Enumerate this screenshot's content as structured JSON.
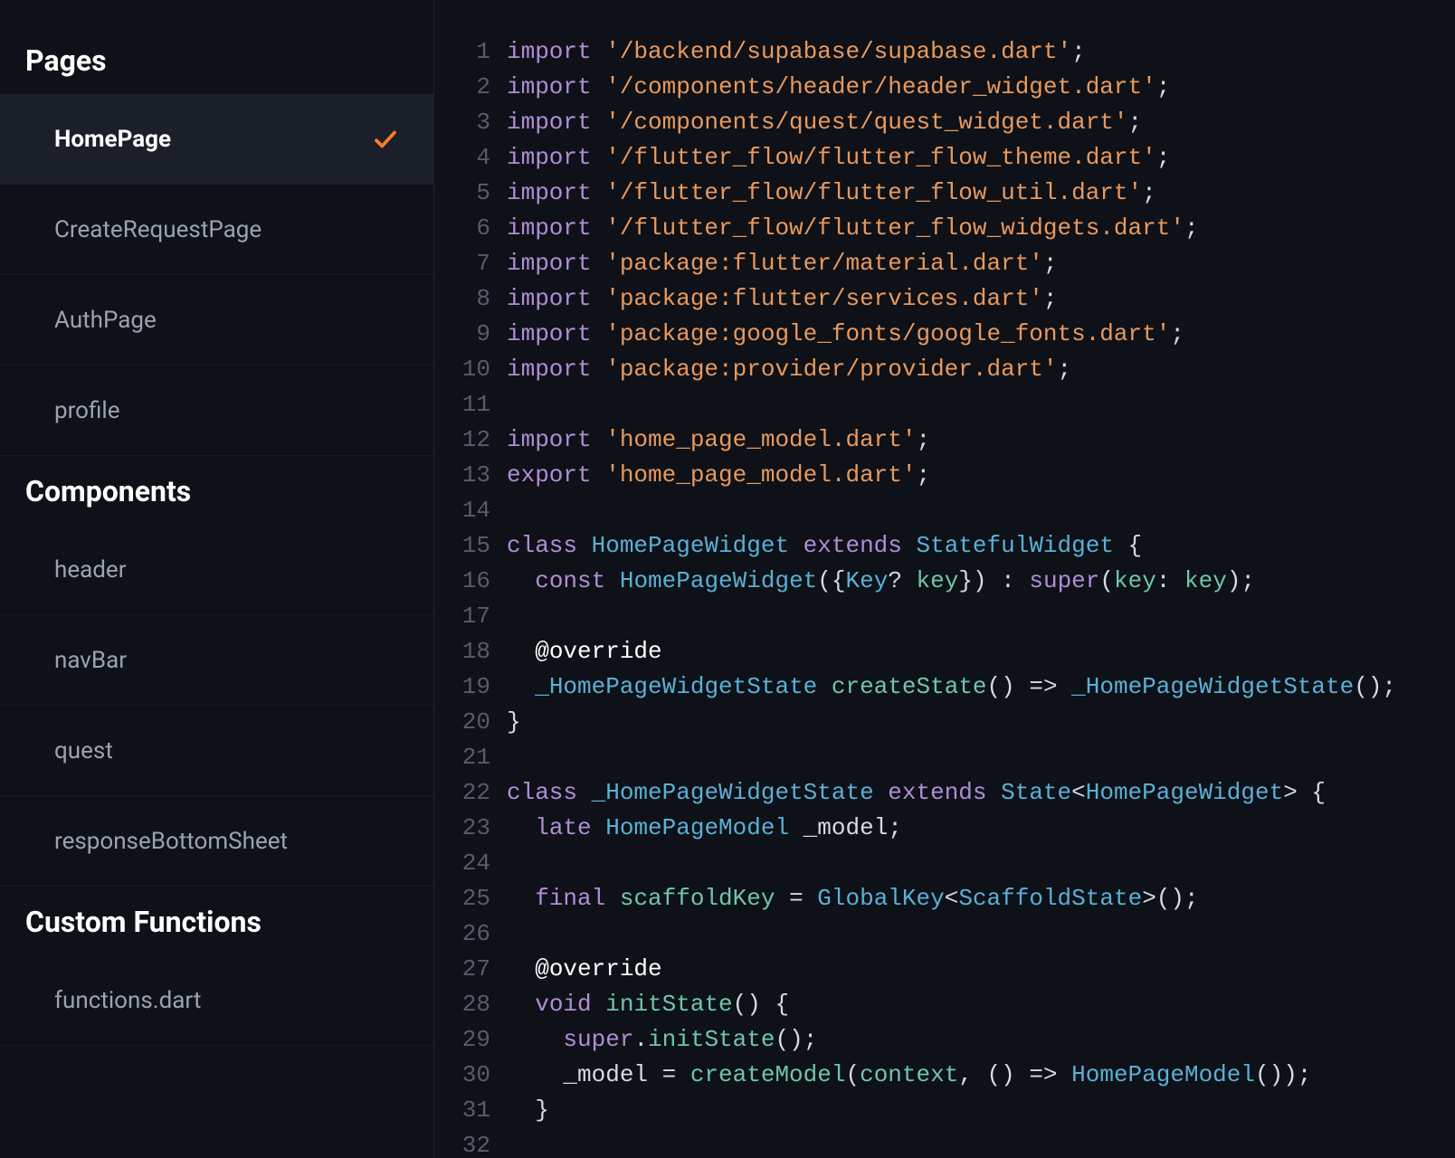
{
  "sidebar": {
    "sections": [
      {
        "title": "Pages",
        "items": [
          {
            "label": "HomePage",
            "selected": true,
            "checked": true
          },
          {
            "label": "CreateRequestPage",
            "selected": false,
            "checked": false
          },
          {
            "label": "AuthPage",
            "selected": false,
            "checked": false
          },
          {
            "label": "profile",
            "selected": false,
            "checked": false
          }
        ]
      },
      {
        "title": "Components",
        "items": [
          {
            "label": "header",
            "selected": false,
            "checked": false
          },
          {
            "label": "navBar",
            "selected": false,
            "checked": false
          },
          {
            "label": "quest",
            "selected": false,
            "checked": false
          },
          {
            "label": "responseBottomSheet",
            "selected": false,
            "checked": false
          }
        ]
      },
      {
        "title": "Custom Functions",
        "items": [
          {
            "label": "functions.dart",
            "selected": false,
            "checked": false
          }
        ]
      }
    ]
  },
  "code": {
    "lines": [
      [
        {
          "t": "import ",
          "c": "kw"
        },
        {
          "t": "'/backend/supabase/supabase.dart'",
          "c": "str"
        },
        {
          "t": ";",
          "c": "punct"
        }
      ],
      [
        {
          "t": "import ",
          "c": "kw"
        },
        {
          "t": "'/components/header/header_widget.dart'",
          "c": "str"
        },
        {
          "t": ";",
          "c": "punct"
        }
      ],
      [
        {
          "t": "import ",
          "c": "kw"
        },
        {
          "t": "'/components/quest/quest_widget.dart'",
          "c": "str"
        },
        {
          "t": ";",
          "c": "punct"
        }
      ],
      [
        {
          "t": "import ",
          "c": "kw"
        },
        {
          "t": "'/flutter_flow/flutter_flow_theme.dart'",
          "c": "str"
        },
        {
          "t": ";",
          "c": "punct"
        }
      ],
      [
        {
          "t": "import ",
          "c": "kw"
        },
        {
          "t": "'/flutter_flow/flutter_flow_util.dart'",
          "c": "str"
        },
        {
          "t": ";",
          "c": "punct"
        }
      ],
      [
        {
          "t": "import ",
          "c": "kw"
        },
        {
          "t": "'/flutter_flow/flutter_flow_widgets.dart'",
          "c": "str"
        },
        {
          "t": ";",
          "c": "punct"
        }
      ],
      [
        {
          "t": "import ",
          "c": "kw"
        },
        {
          "t": "'package:flutter/material.dart'",
          "c": "str"
        },
        {
          "t": ";",
          "c": "punct"
        }
      ],
      [
        {
          "t": "import ",
          "c": "kw"
        },
        {
          "t": "'package:flutter/services.dart'",
          "c": "str"
        },
        {
          "t": ";",
          "c": "punct"
        }
      ],
      [
        {
          "t": "import ",
          "c": "kw"
        },
        {
          "t": "'package:google_fonts/google_fonts.dart'",
          "c": "str"
        },
        {
          "t": ";",
          "c": "punct"
        }
      ],
      [
        {
          "t": "import ",
          "c": "kw"
        },
        {
          "t": "'package:provider/provider.dart'",
          "c": "str"
        },
        {
          "t": ";",
          "c": "punct"
        }
      ],
      [],
      [
        {
          "t": "import ",
          "c": "kw"
        },
        {
          "t": "'home_page_model.dart'",
          "c": "str"
        },
        {
          "t": ";",
          "c": "punct"
        }
      ],
      [
        {
          "t": "export ",
          "c": "kw"
        },
        {
          "t": "'home_page_model.dart'",
          "c": "str"
        },
        {
          "t": ";",
          "c": "punct"
        }
      ],
      [],
      [
        {
          "t": "class ",
          "c": "kw"
        },
        {
          "t": "HomePageWidget",
          "c": "type"
        },
        {
          "t": " extends ",
          "c": "kw"
        },
        {
          "t": "StatefulWidget",
          "c": "type"
        },
        {
          "t": " {",
          "c": "punct"
        }
      ],
      [
        {
          "t": "  ",
          "c": ""
        },
        {
          "t": "const ",
          "c": "kw"
        },
        {
          "t": "HomePageWidget",
          "c": "type"
        },
        {
          "t": "({",
          "c": "punct"
        },
        {
          "t": "Key",
          "c": "type"
        },
        {
          "t": "? ",
          "c": "punct"
        },
        {
          "t": "key",
          "c": "param"
        },
        {
          "t": "}) : ",
          "c": "punct"
        },
        {
          "t": "super",
          "c": "kw"
        },
        {
          "t": "(",
          "c": "punct"
        },
        {
          "t": "key",
          "c": "param"
        },
        {
          "t": ": ",
          "c": "punct"
        },
        {
          "t": "key",
          "c": "param"
        },
        {
          "t": ");",
          "c": "punct"
        }
      ],
      [],
      [
        {
          "t": "  ",
          "c": ""
        },
        {
          "t": "@override",
          "c": "white"
        }
      ],
      [
        {
          "t": "  ",
          "c": ""
        },
        {
          "t": "_HomePageWidgetState",
          "c": "type"
        },
        {
          "t": " ",
          "c": ""
        },
        {
          "t": "createState",
          "c": "ident"
        },
        {
          "t": "() => ",
          "c": "punct"
        },
        {
          "t": "_HomePageWidgetState",
          "c": "type"
        },
        {
          "t": "();",
          "c": "punct"
        }
      ],
      [
        {
          "t": "}",
          "c": "punct"
        }
      ],
      [],
      [
        {
          "t": "class ",
          "c": "kw"
        },
        {
          "t": "_HomePageWidgetState",
          "c": "type"
        },
        {
          "t": " extends ",
          "c": "kw"
        },
        {
          "t": "State",
          "c": "type"
        },
        {
          "t": "<",
          "c": "punct"
        },
        {
          "t": "HomePageWidget",
          "c": "type"
        },
        {
          "t": "> {",
          "c": "punct"
        }
      ],
      [
        {
          "t": "  ",
          "c": ""
        },
        {
          "t": "late ",
          "c": "kw"
        },
        {
          "t": "HomePageModel",
          "c": "type"
        },
        {
          "t": " _model;",
          "c": "punct"
        }
      ],
      [],
      [
        {
          "t": "  ",
          "c": ""
        },
        {
          "t": "final ",
          "c": "kw"
        },
        {
          "t": "scaffoldKey",
          "c": "ident"
        },
        {
          "t": " = ",
          "c": "punct"
        },
        {
          "t": "GlobalKey",
          "c": "type"
        },
        {
          "t": "<",
          "c": "punct"
        },
        {
          "t": "ScaffoldState",
          "c": "type"
        },
        {
          "t": ">();",
          "c": "punct"
        }
      ],
      [],
      [
        {
          "t": "  ",
          "c": ""
        },
        {
          "t": "@override",
          "c": "white"
        }
      ],
      [
        {
          "t": "  ",
          "c": ""
        },
        {
          "t": "void ",
          "c": "kw"
        },
        {
          "t": "initState",
          "c": "ident"
        },
        {
          "t": "() {",
          "c": "punct"
        }
      ],
      [
        {
          "t": "    ",
          "c": ""
        },
        {
          "t": "super",
          "c": "kw"
        },
        {
          "t": ".",
          "c": "punct"
        },
        {
          "t": "initState",
          "c": "ident"
        },
        {
          "t": "();",
          "c": "punct"
        }
      ],
      [
        {
          "t": "    _model = ",
          "c": "punct"
        },
        {
          "t": "createModel",
          "c": "ident"
        },
        {
          "t": "(",
          "c": "punct"
        },
        {
          "t": "context",
          "c": "param"
        },
        {
          "t": ", () => ",
          "c": "punct"
        },
        {
          "t": "HomePageModel",
          "c": "type"
        },
        {
          "t": "());",
          "c": "punct"
        }
      ],
      [
        {
          "t": "  }",
          "c": "punct"
        }
      ],
      []
    ]
  }
}
